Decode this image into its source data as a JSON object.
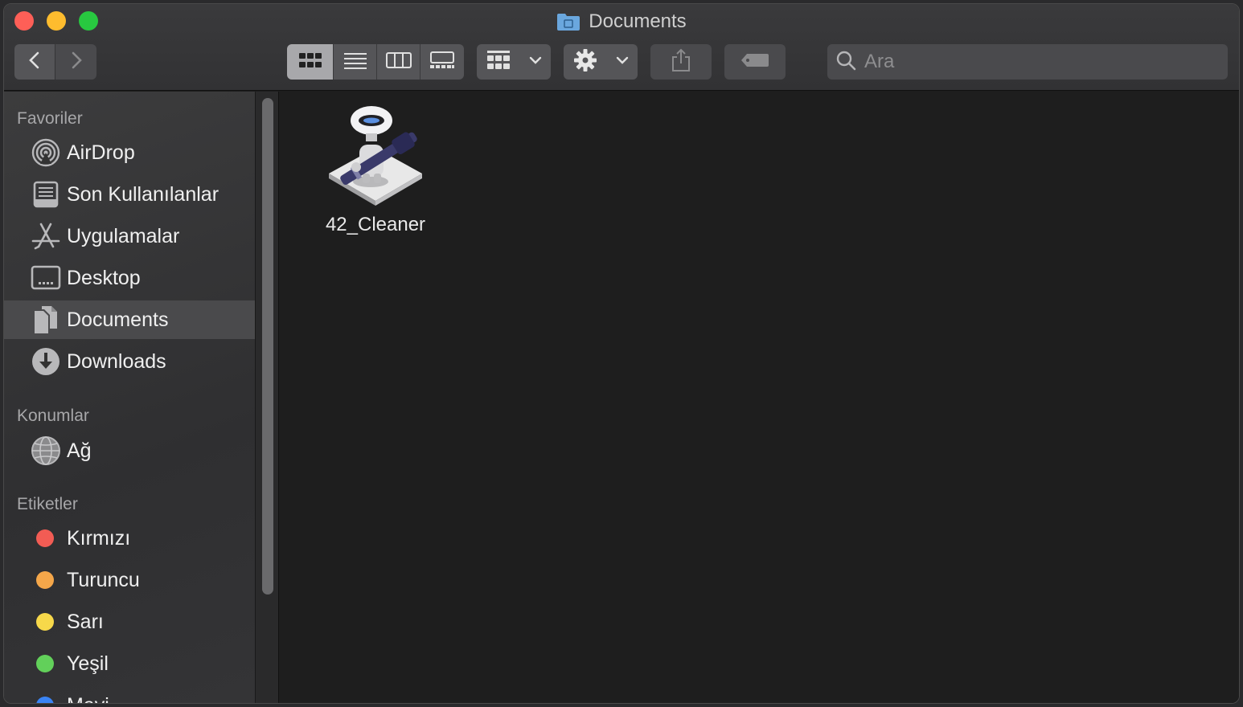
{
  "window": {
    "title": "Documents"
  },
  "toolbar": {
    "back_icon": "chevron-left-icon",
    "forward_icon": "chevron-right-icon",
    "view_modes": [
      "icon-view",
      "list-view",
      "column-view",
      "gallery-view"
    ],
    "active_view": "icon-view",
    "group_icon": "group-grid-icon",
    "action_icon": "gear-icon",
    "share_icon": "share-icon",
    "tag_icon": "tag-icon"
  },
  "search": {
    "placeholder": "Ara",
    "value": ""
  },
  "sidebar": {
    "favorites_header": "Favoriler",
    "favorites": [
      {
        "label": "AirDrop",
        "icon": "airdrop-icon"
      },
      {
        "label": "Son Kullanılanlar",
        "icon": "recents-icon"
      },
      {
        "label": "Uygulamalar",
        "icon": "applications-icon"
      },
      {
        "label": "Desktop",
        "icon": "desktop-icon"
      },
      {
        "label": "Documents",
        "icon": "documents-icon",
        "selected": true
      },
      {
        "label": "Downloads",
        "icon": "downloads-icon"
      }
    ],
    "locations_header": "Konumlar",
    "locations": [
      {
        "label": "Ağ",
        "icon": "network-icon"
      }
    ],
    "tags_header": "Etiketler",
    "tags": [
      {
        "label": "Kırmızı",
        "color": "#f25c54"
      },
      {
        "label": "Turuncu",
        "color": "#f5a74a"
      },
      {
        "label": "Sarı",
        "color": "#f7d84a"
      },
      {
        "label": "Yeşil",
        "color": "#62d05a"
      },
      {
        "label": "Mavi",
        "color": "#3a84f5"
      }
    ]
  },
  "content": {
    "files": [
      {
        "name": "42_Cleaner",
        "icon": "automator-app-icon"
      }
    ]
  }
}
